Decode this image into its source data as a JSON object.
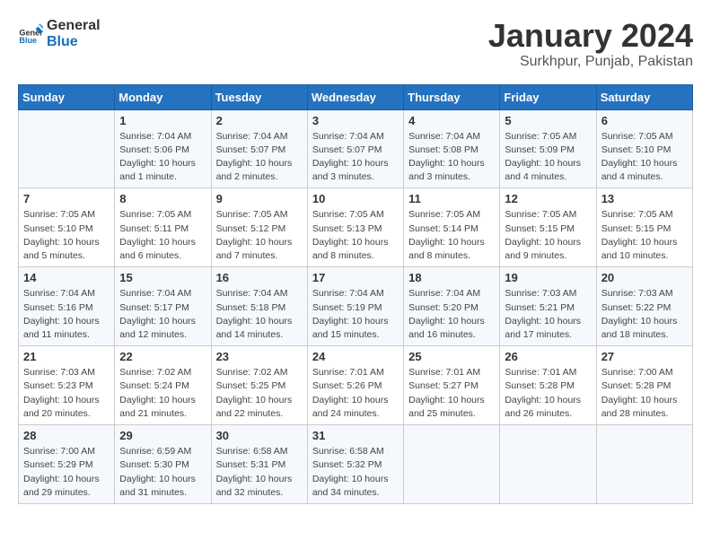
{
  "header": {
    "logo": {
      "text_general": "General",
      "text_blue": "Blue"
    },
    "title": "January 2024",
    "subtitle": "Surkhpur, Punjab, Pakistan"
  },
  "days_of_week": [
    "Sunday",
    "Monday",
    "Tuesday",
    "Wednesday",
    "Thursday",
    "Friday",
    "Saturday"
  ],
  "weeks": [
    [
      {
        "day": "",
        "info": ""
      },
      {
        "day": "1",
        "info": "Sunrise: 7:04 AM\nSunset: 5:06 PM\nDaylight: 10 hours\nand 1 minute."
      },
      {
        "day": "2",
        "info": "Sunrise: 7:04 AM\nSunset: 5:07 PM\nDaylight: 10 hours\nand 2 minutes."
      },
      {
        "day": "3",
        "info": "Sunrise: 7:04 AM\nSunset: 5:07 PM\nDaylight: 10 hours\nand 3 minutes."
      },
      {
        "day": "4",
        "info": "Sunrise: 7:04 AM\nSunset: 5:08 PM\nDaylight: 10 hours\nand 3 minutes."
      },
      {
        "day": "5",
        "info": "Sunrise: 7:05 AM\nSunset: 5:09 PM\nDaylight: 10 hours\nand 4 minutes."
      },
      {
        "day": "6",
        "info": "Sunrise: 7:05 AM\nSunset: 5:10 PM\nDaylight: 10 hours\nand 4 minutes."
      }
    ],
    [
      {
        "day": "7",
        "info": "Sunrise: 7:05 AM\nSunset: 5:10 PM\nDaylight: 10 hours\nand 5 minutes."
      },
      {
        "day": "8",
        "info": "Sunrise: 7:05 AM\nSunset: 5:11 PM\nDaylight: 10 hours\nand 6 minutes."
      },
      {
        "day": "9",
        "info": "Sunrise: 7:05 AM\nSunset: 5:12 PM\nDaylight: 10 hours\nand 7 minutes."
      },
      {
        "day": "10",
        "info": "Sunrise: 7:05 AM\nSunset: 5:13 PM\nDaylight: 10 hours\nand 8 minutes."
      },
      {
        "day": "11",
        "info": "Sunrise: 7:05 AM\nSunset: 5:14 PM\nDaylight: 10 hours\nand 8 minutes."
      },
      {
        "day": "12",
        "info": "Sunrise: 7:05 AM\nSunset: 5:15 PM\nDaylight: 10 hours\nand 9 minutes."
      },
      {
        "day": "13",
        "info": "Sunrise: 7:05 AM\nSunset: 5:15 PM\nDaylight: 10 hours\nand 10 minutes."
      }
    ],
    [
      {
        "day": "14",
        "info": "Sunrise: 7:04 AM\nSunset: 5:16 PM\nDaylight: 10 hours\nand 11 minutes."
      },
      {
        "day": "15",
        "info": "Sunrise: 7:04 AM\nSunset: 5:17 PM\nDaylight: 10 hours\nand 12 minutes."
      },
      {
        "day": "16",
        "info": "Sunrise: 7:04 AM\nSunset: 5:18 PM\nDaylight: 10 hours\nand 14 minutes."
      },
      {
        "day": "17",
        "info": "Sunrise: 7:04 AM\nSunset: 5:19 PM\nDaylight: 10 hours\nand 15 minutes."
      },
      {
        "day": "18",
        "info": "Sunrise: 7:04 AM\nSunset: 5:20 PM\nDaylight: 10 hours\nand 16 minutes."
      },
      {
        "day": "19",
        "info": "Sunrise: 7:03 AM\nSunset: 5:21 PM\nDaylight: 10 hours\nand 17 minutes."
      },
      {
        "day": "20",
        "info": "Sunrise: 7:03 AM\nSunset: 5:22 PM\nDaylight: 10 hours\nand 18 minutes."
      }
    ],
    [
      {
        "day": "21",
        "info": "Sunrise: 7:03 AM\nSunset: 5:23 PM\nDaylight: 10 hours\nand 20 minutes."
      },
      {
        "day": "22",
        "info": "Sunrise: 7:02 AM\nSunset: 5:24 PM\nDaylight: 10 hours\nand 21 minutes."
      },
      {
        "day": "23",
        "info": "Sunrise: 7:02 AM\nSunset: 5:25 PM\nDaylight: 10 hours\nand 22 minutes."
      },
      {
        "day": "24",
        "info": "Sunrise: 7:01 AM\nSunset: 5:26 PM\nDaylight: 10 hours\nand 24 minutes."
      },
      {
        "day": "25",
        "info": "Sunrise: 7:01 AM\nSunset: 5:27 PM\nDaylight: 10 hours\nand 25 minutes."
      },
      {
        "day": "26",
        "info": "Sunrise: 7:01 AM\nSunset: 5:28 PM\nDaylight: 10 hours\nand 26 minutes."
      },
      {
        "day": "27",
        "info": "Sunrise: 7:00 AM\nSunset: 5:28 PM\nDaylight: 10 hours\nand 28 minutes."
      }
    ],
    [
      {
        "day": "28",
        "info": "Sunrise: 7:00 AM\nSunset: 5:29 PM\nDaylight: 10 hours\nand 29 minutes."
      },
      {
        "day": "29",
        "info": "Sunrise: 6:59 AM\nSunset: 5:30 PM\nDaylight: 10 hours\nand 31 minutes."
      },
      {
        "day": "30",
        "info": "Sunrise: 6:58 AM\nSunset: 5:31 PM\nDaylight: 10 hours\nand 32 minutes."
      },
      {
        "day": "31",
        "info": "Sunrise: 6:58 AM\nSunset: 5:32 PM\nDaylight: 10 hours\nand 34 minutes."
      },
      {
        "day": "",
        "info": ""
      },
      {
        "day": "",
        "info": ""
      },
      {
        "day": "",
        "info": ""
      }
    ]
  ]
}
